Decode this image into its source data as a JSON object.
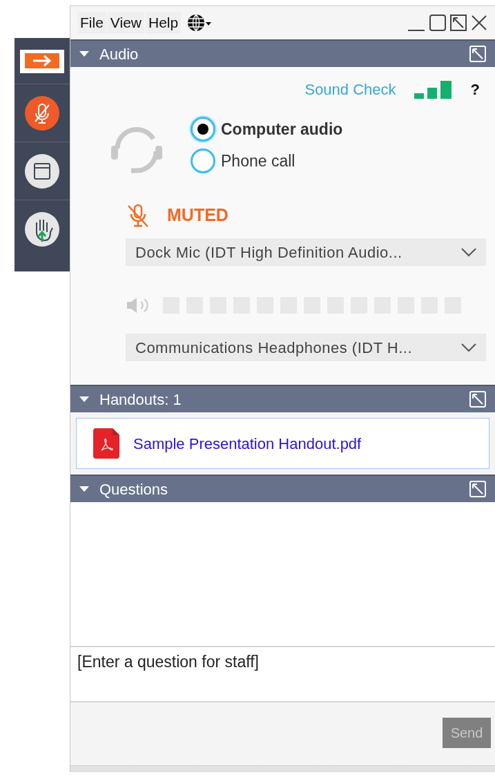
{
  "menu": [
    "File",
    "View",
    "Help"
  ],
  "audio": {
    "title": "Audio",
    "sound_check": "Sound Check",
    "help": "?",
    "options": [
      {
        "label": "Computer audio",
        "selected": true
      },
      {
        "label": "Phone call",
        "selected": false
      }
    ],
    "mic_status": "MUTED",
    "microphone": "Dock Mic (IDT High Definition Audio...",
    "speaker": "Communications Headphones (IDT H..."
  },
  "handouts": {
    "title": "Handouts: 1",
    "files": [
      "Sample Presentation Handout.pdf"
    ]
  },
  "questions": {
    "title": "Questions",
    "placeholder": "[Enter a question for staff]",
    "send": {
      "label": "Send",
      "disabled": true
    }
  }
}
